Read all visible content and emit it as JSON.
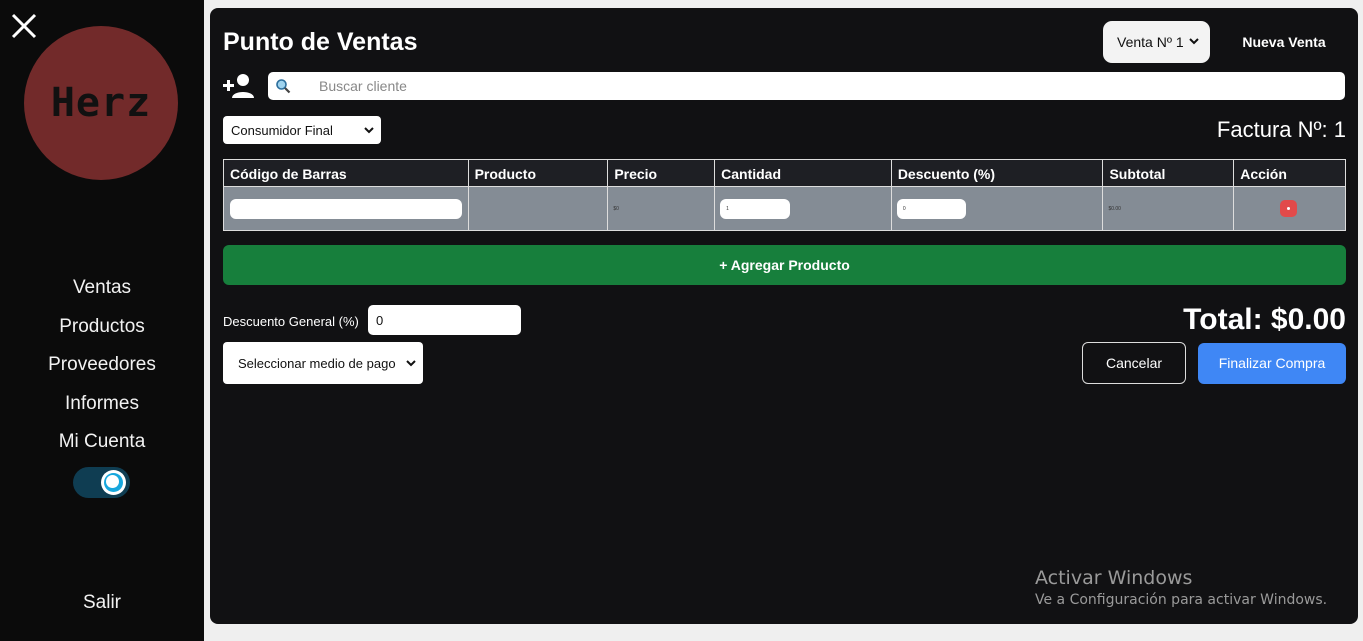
{
  "sidebar": {
    "logo_text": "Herz",
    "nav": [
      "Ventas",
      "Productos",
      "Proveedores",
      "Informes",
      "Mi Cuenta"
    ],
    "logout": "Salir"
  },
  "header": {
    "title": "Punto de Ventas",
    "sale_selector": "Venta Nº 1",
    "new_sale": "Nueva Venta"
  },
  "client": {
    "search_placeholder": "Buscar cliente",
    "type": "Consumidor Final"
  },
  "invoice": "Factura Nº: 1",
  "table": {
    "headers": [
      "Código de Barras",
      "Producto",
      "Precio",
      "Cantidad",
      "Descuento (%)",
      "Subtotal",
      "Acción"
    ],
    "row": {
      "barcode": "",
      "product": "",
      "price": "$0",
      "quantity": "1",
      "discount": "0",
      "subtotal": "$0.00"
    }
  },
  "add_product": "+ Agregar Producto",
  "discount_general": {
    "label": "Descuento General (%)",
    "value": "0"
  },
  "total": "Total: $0.00",
  "payment": "Seleccionar medio de pago",
  "actions": {
    "cancel": "Cancelar",
    "finish": "Finalizar Compra"
  },
  "watermark": {
    "title": "Activar Windows",
    "subtitle": "Ve a Configuración para activar Windows."
  },
  "colors": {
    "add_product": "#177f3c",
    "finish": "#3f87f5",
    "remove": "#e24a4a",
    "logo_bg": "#722a2a",
    "toggle": "#17a7dd"
  }
}
